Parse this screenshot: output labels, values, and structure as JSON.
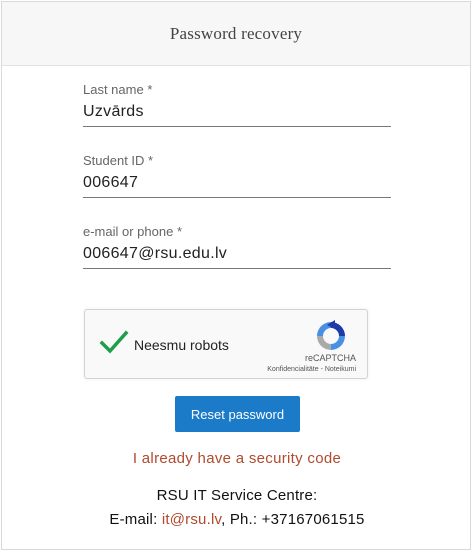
{
  "header": {
    "title": "Password recovery"
  },
  "form": {
    "last_name": {
      "label": "Last name *",
      "value": "Uzvārds"
    },
    "student_id": {
      "label": "Student ID *",
      "value": "006647"
    },
    "contact": {
      "label": "e-mail or phone *",
      "value": "006647@rsu.edu.lv"
    }
  },
  "recaptcha": {
    "label": "Neesmu robots",
    "brand": "reCAPTCHA",
    "privacy_link": "Konfidencialitāte",
    "separator": " - ",
    "terms_link": "Noteikumi",
    "check_color": "#1e9e4a"
  },
  "actions": {
    "reset_label": "Reset password",
    "security_code_link": "I already have a security code"
  },
  "footer": {
    "centre": "RSU IT Service Centre:",
    "email_prefix": "E-mail: ",
    "email": "it@rsu.lv",
    "phone_prefix": ", Ph.: ",
    "phone": "+37167061515"
  },
  "colors": {
    "accent": "#1c7bc9",
    "link": "#b04a2e"
  }
}
